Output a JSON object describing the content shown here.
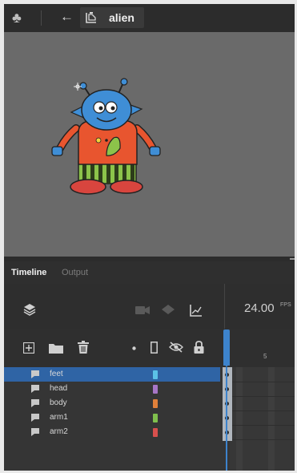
{
  "topbar": {
    "scene_icon": "club-icon",
    "back_icon": "back-arrow-icon",
    "symbol_icon": "movie-clip-symbol-icon",
    "symbol_name": "alien"
  },
  "stage": {
    "background": "#6a6a6a",
    "artwork": "alien-character"
  },
  "panel": {
    "tabs": [
      {
        "label": "Timeline"
      },
      {
        "label": "Output"
      }
    ],
    "header_icons": [
      "layers-icon",
      "camera-icon",
      "layer-depth-icon",
      "graph-icon"
    ],
    "fps_value": "24.00",
    "fps_unit": "FPS",
    "tool_icons": [
      "add-layer-icon",
      "folder-icon",
      "delete-icon",
      "dot-icon",
      "outline-icon",
      "visibility-icon",
      "lock-icon"
    ],
    "ruler_label": "5"
  },
  "layers": [
    {
      "name": "feet",
      "color": "#5bc2e7",
      "selected": true
    },
    {
      "name": "head",
      "color": "#a776c6",
      "selected": false
    },
    {
      "name": "body",
      "color": "#e0803a",
      "selected": false
    },
    {
      "name": "arm1",
      "color": "#7fbf4d",
      "selected": false
    },
    {
      "name": "arm2",
      "color": "#d8504d",
      "selected": false
    }
  ],
  "accent_color": "#3d83cc"
}
